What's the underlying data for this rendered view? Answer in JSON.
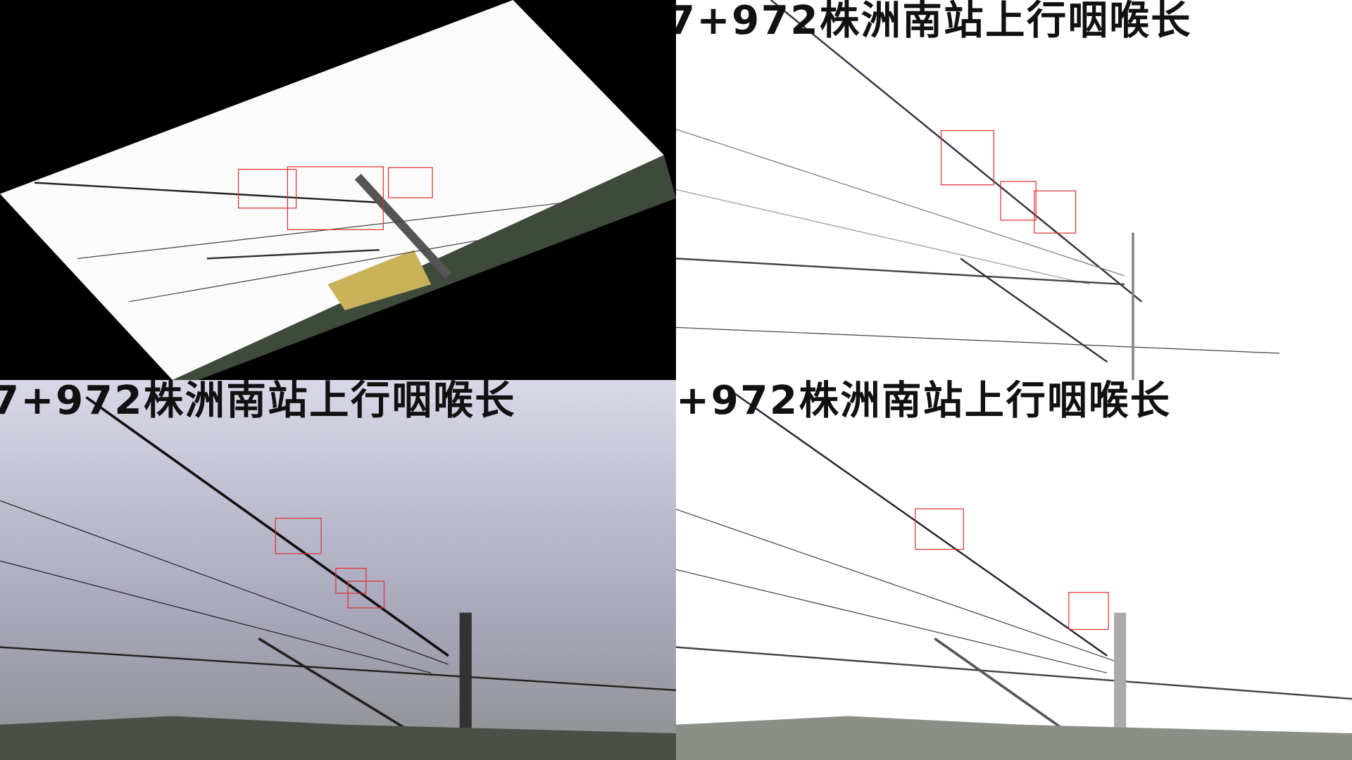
{
  "panels": [
    {
      "name": "rotated-frame",
      "overlay_text": "",
      "detections": 3
    },
    {
      "name": "edge-frame",
      "overlay_text": "7+972株洲南站上行咽喉长",
      "detections": 3
    },
    {
      "name": "original-frame",
      "overlay_text": "7+972株洲南站上行咽喉长",
      "detections": 3
    },
    {
      "name": "brightened-frame",
      "overlay_text": "+972株洲南站上行咽喉长",
      "detections": 2
    }
  ],
  "colors": {
    "box": "#e03030",
    "sky_original": "#a9a8bd"
  }
}
